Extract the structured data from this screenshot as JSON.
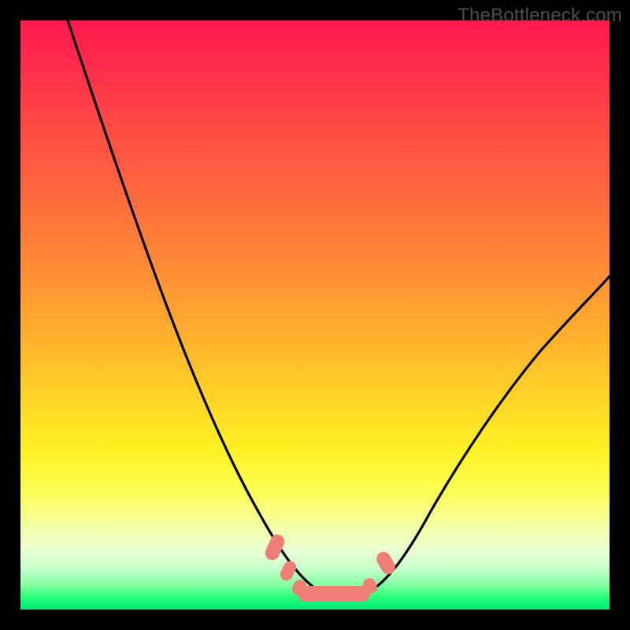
{
  "watermark": {
    "text": "TheBottleneck.com"
  },
  "chart_data": {
    "type": "line",
    "title": "",
    "xlabel": "",
    "ylabel": "",
    "xlim": [
      0,
      100
    ],
    "ylim": [
      0,
      100
    ],
    "grid": false,
    "legend": false,
    "background": "rainbow-vertical-gradient",
    "series": [
      {
        "name": "bottleneck-curve",
        "x": [
          8,
          12,
          16,
          20,
          24,
          28,
          32,
          36,
          40,
          44,
          47,
          50,
          53,
          56,
          59,
          62,
          66,
          70,
          75,
          80,
          85,
          90,
          95,
          100
        ],
        "y": [
          100,
          90,
          78,
          66,
          55,
          44,
          34,
          25,
          17,
          10,
          6,
          3,
          2,
          2,
          3,
          6,
          12,
          19,
          27,
          35,
          42,
          48,
          54,
          59
        ],
        "stroke": "#000000",
        "stroke_width": 3
      }
    ],
    "markers": [
      {
        "name": "trough-highlight",
        "shape": "rounded-band",
        "x_range": [
          45,
          62
        ],
        "y": 2,
        "color": "#f08078"
      },
      {
        "name": "left-mark-upper",
        "shape": "capsule",
        "x": 43,
        "y": 10,
        "color": "#f08078"
      },
      {
        "name": "left-mark-lower",
        "shape": "capsule",
        "x": 45,
        "y": 6,
        "color": "#f08078"
      },
      {
        "name": "right-mark",
        "shape": "capsule",
        "x": 63,
        "y": 8,
        "color": "#f08078"
      }
    ]
  }
}
